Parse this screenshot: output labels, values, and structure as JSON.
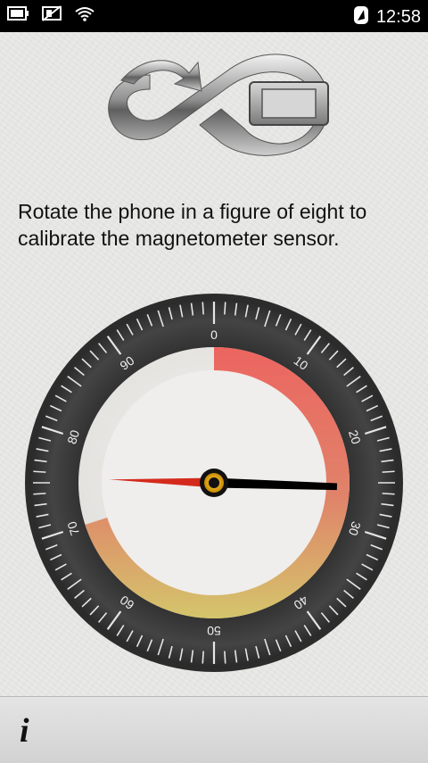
{
  "status_bar": {
    "time": "12:58",
    "icons": [
      "battery-icon",
      "no-sim-icon",
      "wifi-icon",
      "location-icon"
    ]
  },
  "app": {
    "logo_icon": "figure-eight-rotate-phone-icon",
    "instruction": "Rotate the phone in a figure of eight to calibrate the magnetometer sensor."
  },
  "dial": {
    "scale_labels": [
      "0",
      "10",
      "20",
      "30",
      "40",
      "50",
      "60",
      "70",
      "80",
      "90"
    ],
    "needle_value": 25.5,
    "colors": {
      "ring": "#3b3b3b",
      "needle_north": "#d42a1c",
      "needle_south": "#000000",
      "arc_start": "#ec6560",
      "arc_end": "#d4c56b"
    }
  },
  "bottom_bar": {
    "info_label": "i"
  }
}
